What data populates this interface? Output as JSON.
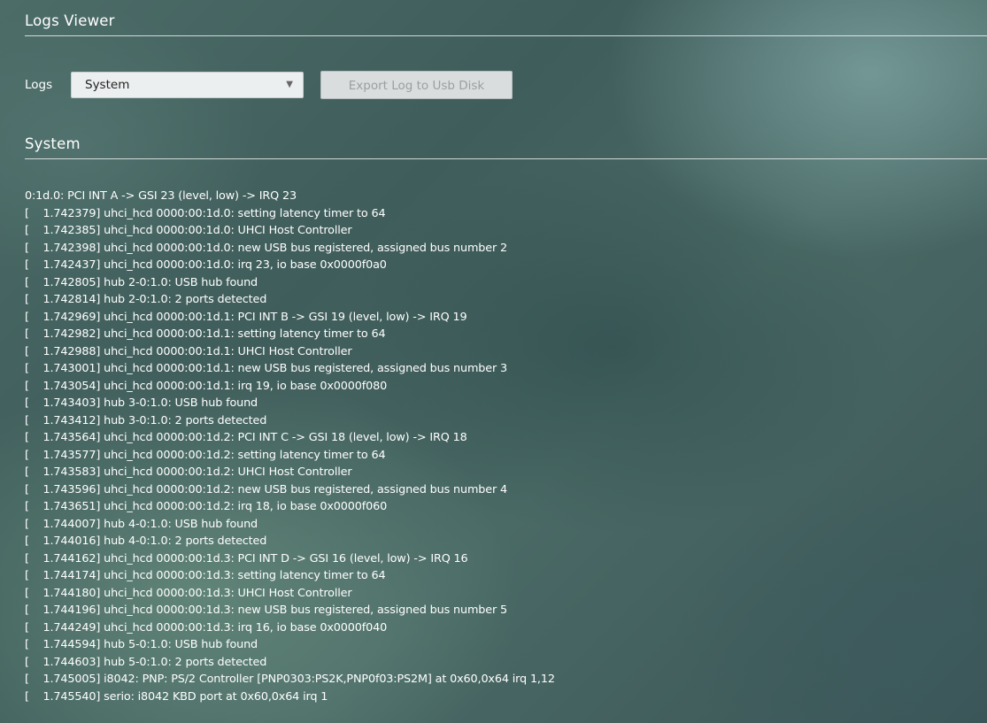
{
  "header": {
    "title": "Logs Viewer"
  },
  "controls": {
    "logs_label": "Logs",
    "selected_log": "System",
    "export_label": "Export Log to Usb Disk"
  },
  "log_section": {
    "title": "System",
    "lines": [
      "0:1d.0: PCI INT A -> GSI 23 (level, low) -> IRQ 23",
      "[    1.742379] uhci_hcd 0000:00:1d.0: setting latency timer to 64",
      "[    1.742385] uhci_hcd 0000:00:1d.0: UHCI Host Controller",
      "[    1.742398] uhci_hcd 0000:00:1d.0: new USB bus registered, assigned bus number 2",
      "[    1.742437] uhci_hcd 0000:00:1d.0: irq 23, io base 0x0000f0a0",
      "[    1.742805] hub 2-0:1.0: USB hub found",
      "[    1.742814] hub 2-0:1.0: 2 ports detected",
      "[    1.742969] uhci_hcd 0000:00:1d.1: PCI INT B -> GSI 19 (level, low) -> IRQ 19",
      "[    1.742982] uhci_hcd 0000:00:1d.1: setting latency timer to 64",
      "[    1.742988] uhci_hcd 0000:00:1d.1: UHCI Host Controller",
      "[    1.743001] uhci_hcd 0000:00:1d.1: new USB bus registered, assigned bus number 3",
      "[    1.743054] uhci_hcd 0000:00:1d.1: irq 19, io base 0x0000f080",
      "[    1.743403] hub 3-0:1.0: USB hub found",
      "[    1.743412] hub 3-0:1.0: 2 ports detected",
      "[    1.743564] uhci_hcd 0000:00:1d.2: PCI INT C -> GSI 18 (level, low) -> IRQ 18",
      "[    1.743577] uhci_hcd 0000:00:1d.2: setting latency timer to 64",
      "[    1.743583] uhci_hcd 0000:00:1d.2: UHCI Host Controller",
      "[    1.743596] uhci_hcd 0000:00:1d.2: new USB bus registered, assigned bus number 4",
      "[    1.743651] uhci_hcd 0000:00:1d.2: irq 18, io base 0x0000f060",
      "[    1.744007] hub 4-0:1.0: USB hub found",
      "[    1.744016] hub 4-0:1.0: 2 ports detected",
      "[    1.744162] uhci_hcd 0000:00:1d.3: PCI INT D -> GSI 16 (level, low) -> IRQ 16",
      "[    1.744174] uhci_hcd 0000:00:1d.3: setting latency timer to 64",
      "[    1.744180] uhci_hcd 0000:00:1d.3: UHCI Host Controller",
      "[    1.744196] uhci_hcd 0000:00:1d.3: new USB bus registered, assigned bus number 5",
      "[    1.744249] uhci_hcd 0000:00:1d.3: irq 16, io base 0x0000f040",
      "[    1.744594] hub 5-0:1.0: USB hub found",
      "[    1.744603] hub 5-0:1.0: 2 ports detected",
      "[    1.745005] i8042: PNP: PS/2 Controller [PNP0303:PS2K,PNP0f03:PS2M] at 0x60,0x64 irq 1,12",
      "[    1.745540] serio: i8042 KBD port at 0x60,0x64 irq 1"
    ]
  },
  "icons": {
    "dropdown": "chevron-down-icon"
  }
}
